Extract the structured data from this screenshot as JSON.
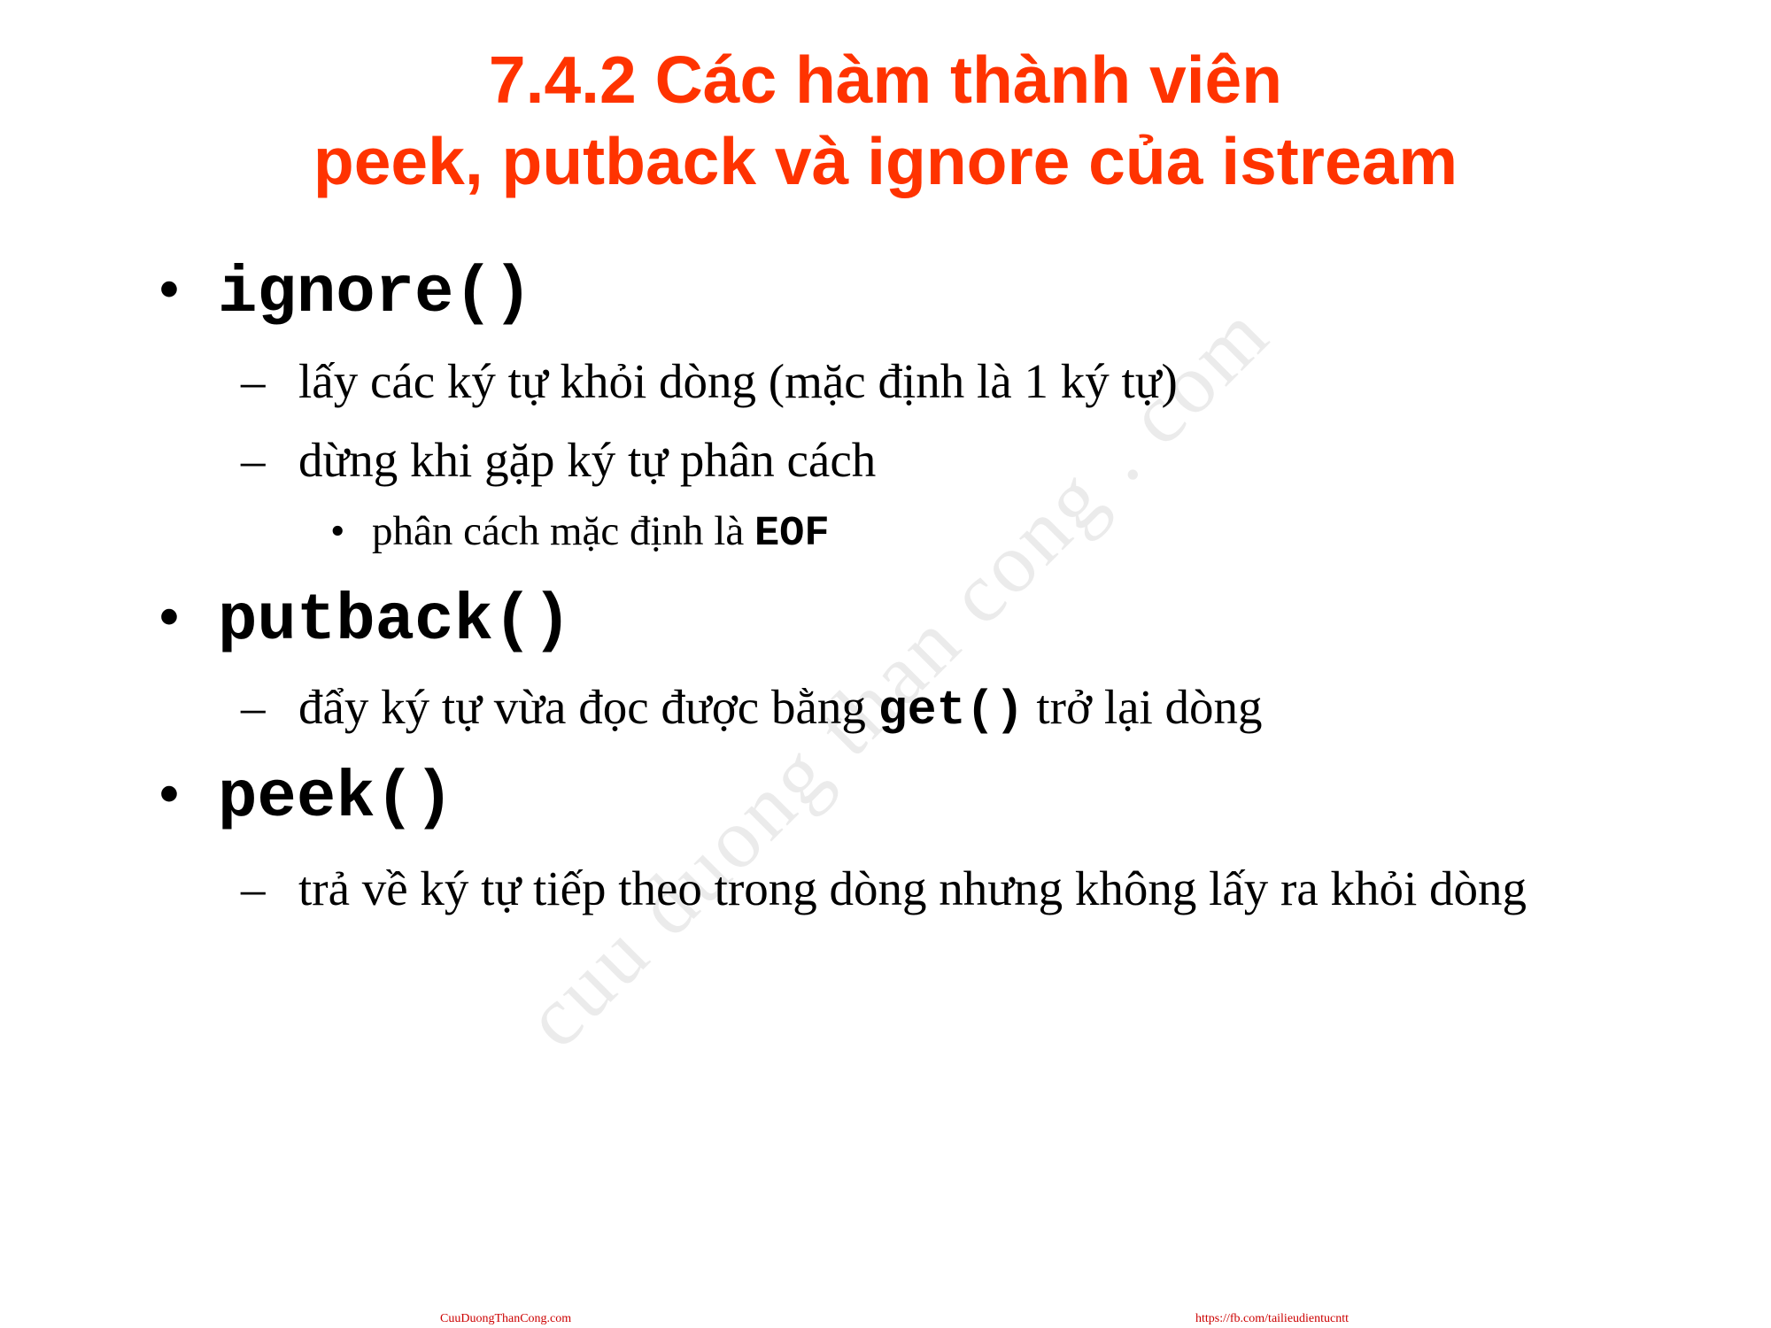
{
  "slide": {
    "title_line1": "7.4.2 Các hàm thành viên",
    "title_line2": "peek, putback và ignore của istream",
    "watermark": "cuu duong than cong . com",
    "items": [
      {
        "bullet": "•",
        "code": "ignore()",
        "subitems": [
          {
            "dash": "–",
            "text": "lấy các ký tự khỏi dòng (mặc định là 1 ký tự)"
          },
          {
            "dash": "–",
            "text": "dừng khi gặp ký tự phân cách"
          }
        ],
        "subsubitems": [
          {
            "dot": "•",
            "text": "phân cách mặc định là ",
            "code": "EOF"
          }
        ]
      },
      {
        "bullet": "•",
        "code": "putback()",
        "subitems": [
          {
            "dash": "–",
            "text_before": "đẩy ký tự vừa đọc được bằng ",
            "code": "get()",
            "text_after": " trở lại dòng"
          }
        ]
      },
      {
        "bullet": "•",
        "code": "peek()",
        "subitems": [
          {
            "dash": "–",
            "text": "trả về ký tự tiếp theo trong dòng nhưng không lấy ra khỏi dòng"
          }
        ]
      }
    ]
  },
  "footer": {
    "left": "CuuDuongThanCong.com",
    "right": "https://fb.com/tailieudientucntt"
  },
  "colors": {
    "title": "#ff3300",
    "footer": "#cc0000"
  }
}
